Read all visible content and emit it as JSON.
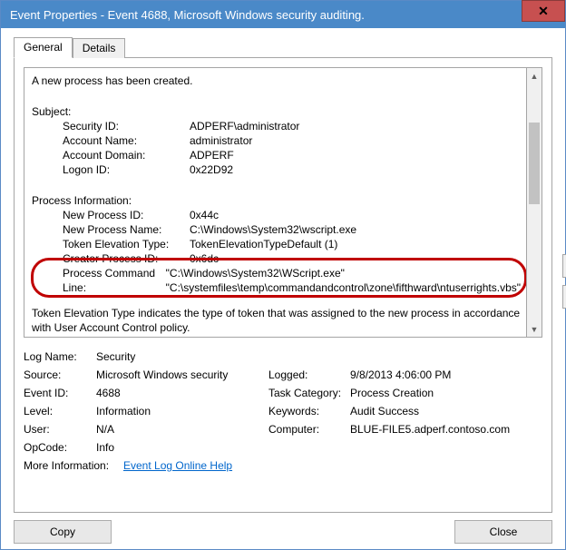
{
  "window": {
    "title": "Event Properties - Event 4688, Microsoft Windows security auditing."
  },
  "tabs": {
    "general": "General",
    "details": "Details"
  },
  "main": {
    "created_line": "A new process has been created.",
    "subject_heading": "Subject:",
    "security_id_label": "Security ID:",
    "security_id_value": "ADPERF\\administrator",
    "account_name_label": "Account Name:",
    "account_name_value": "administrator",
    "account_domain_label": "Account Domain:",
    "account_domain_value": "ADPERF",
    "logon_id_label": "Logon ID:",
    "logon_id_value": "0x22D92",
    "proc_info_heading": "Process Information:",
    "new_pid_label": "New Process ID:",
    "new_pid_value": "0x44c",
    "new_pname_label": "New Process Name:",
    "new_pname_value": "C:\\Windows\\System32\\wscript.exe",
    "token_elev_label": "Token Elevation Type:",
    "token_elev_value": "TokenElevationTypeDefault (1)",
    "creator_pid_label": "Creator Process ID:",
    "creator_pid_value": "0x6dc",
    "cmdline_label": "Process Command Line:",
    "cmdline_value": "\"C:\\Windows\\System32\\WScript.exe\" \"C:\\systemfiles\\temp\\commandandcontrol\\zone\\fifthward\\ntuserrights.vbs\"",
    "footnote": "Token Elevation Type indicates the type of token that was assigned to the new process in accordance with User Account Control policy."
  },
  "props": {
    "log_name_label": "Log Name:",
    "log_name_value": "Security",
    "source_label": "Source:",
    "source_value": "Microsoft Windows security",
    "logged_label": "Logged:",
    "logged_value": "9/8/2013 4:06:00 PM",
    "event_id_label": "Event ID:",
    "event_id_value": "4688",
    "task_cat_label": "Task Category:",
    "task_cat_value": "Process Creation",
    "level_label": "Level:",
    "level_value": "Information",
    "keywords_label": "Keywords:",
    "keywords_value": "Audit Success",
    "user_label": "User:",
    "user_value": "N/A",
    "computer_label": "Computer:",
    "computer_value": "BLUE-FILE5.adperf.contoso.com",
    "opcode_label": "OpCode:",
    "opcode_value": "Info",
    "more_info_label": "More Information:",
    "more_info_link": "Event Log Online Help"
  },
  "buttons": {
    "copy": "Copy",
    "close": "Close"
  }
}
